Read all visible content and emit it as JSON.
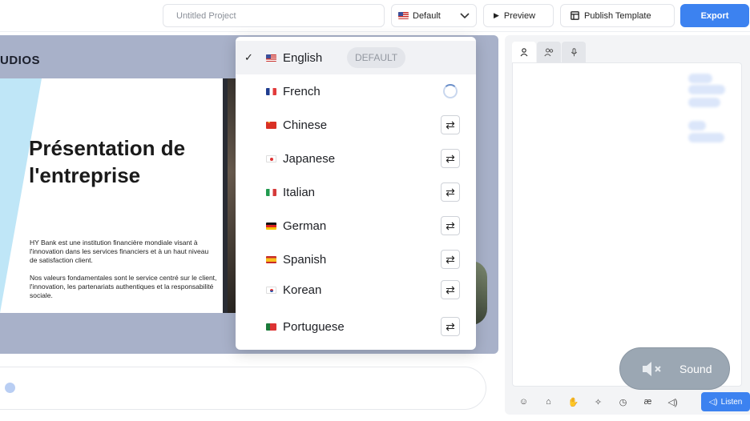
{
  "topbar": {
    "project_placeholder": "Untitled Project",
    "language_selected": "Default",
    "preview_label": "Preview",
    "publish_label": "Publish Template",
    "export_label": "Export"
  },
  "stage": {
    "studio_label": "UDIOS",
    "slide_title": "Présentation de l'entreprise",
    "slide_body": "HY Bank est une institution financière mondiale visant à l'innovation dans les services financiers et à un haut niveau de satisfaction client.\n\nNos valeurs fondamentales sont le service centré sur le client, l'innovation, les partenariats authentiques et la responsabilité sociale."
  },
  "languages": [
    {
      "name": "English",
      "flag": "flag-us",
      "selected": true,
      "badge": "DEFAULT"
    },
    {
      "name": "French",
      "flag": "flag-fr",
      "state": "loading"
    },
    {
      "name": "Chinese",
      "flag": "flag-cn",
      "state": "translate"
    },
    {
      "name": "Japanese",
      "flag": "flag-jp",
      "state": "translate"
    },
    {
      "name": "Italian",
      "flag": "flag-it",
      "state": "translate"
    },
    {
      "name": "German",
      "flag": "flag-de",
      "state": "translate"
    },
    {
      "name": "Spanish",
      "flag": "flag-es",
      "state": "translate"
    },
    {
      "name": "Korean",
      "flag": "flag-kr",
      "state": "translate"
    },
    {
      "name": "Portuguese",
      "flag": "flag-pt",
      "state": "translate"
    }
  ],
  "right_panel": {
    "sound_label": "Sound",
    "listen_label": "Listen"
  },
  "colors": {
    "accent": "#3c82f0",
    "stage_bg": "#a8b1c9"
  }
}
